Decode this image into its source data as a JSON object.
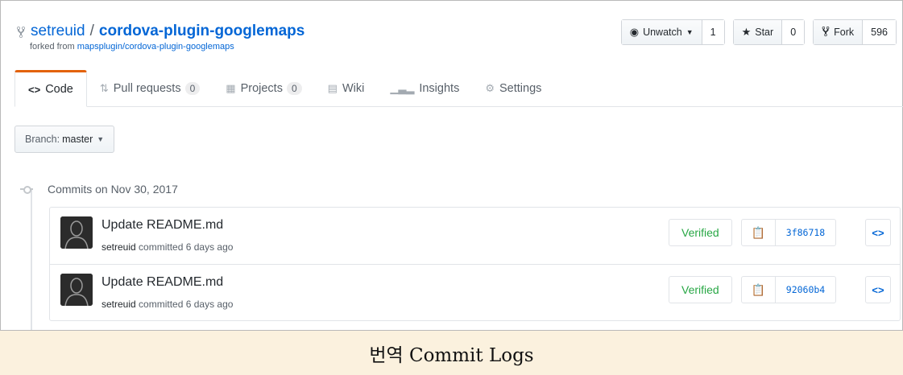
{
  "repo": {
    "owner": "setreuid",
    "separator": "/",
    "name": "cordova-plugin-googlemaps",
    "forked_prefix": "forked from",
    "forked_from": "mapsplugin/cordova-plugin-googlemaps"
  },
  "actions": {
    "watch": {
      "label": "Unwatch",
      "count": "1"
    },
    "star": {
      "label": "Star",
      "count": "0"
    },
    "fork": {
      "label": "Fork",
      "count": "596"
    }
  },
  "tabs": [
    {
      "label": "Code",
      "icon": "code-icon",
      "selected": true
    },
    {
      "label": "Pull requests",
      "count": "0",
      "icon": "pull-request-icon"
    },
    {
      "label": "Projects",
      "count": "0",
      "icon": "project-icon"
    },
    {
      "label": "Wiki",
      "icon": "book-icon"
    },
    {
      "label": "Insights",
      "icon": "graph-icon"
    },
    {
      "label": "Settings",
      "icon": "gear-icon"
    }
  ],
  "branch": {
    "prefix": "Branch:",
    "name": "master"
  },
  "commit_group": {
    "title": "Commits on Nov 30, 2017"
  },
  "commits": [
    {
      "message": "Update README.md",
      "author": "setreuid",
      "meta": "committed 6 days ago",
      "verified": "Verified",
      "sha": "3f86718"
    },
    {
      "message": "Update README.md",
      "author": "setreuid",
      "meta": "committed 6 days ago",
      "verified": "Verified",
      "sha": "92060b4"
    }
  ],
  "caption": "번역 Commit Logs",
  "colors": {
    "accent_tab": "#e36209",
    "link": "#0366d6",
    "verified": "#28a745",
    "caption_bg": "#fbf1de"
  }
}
